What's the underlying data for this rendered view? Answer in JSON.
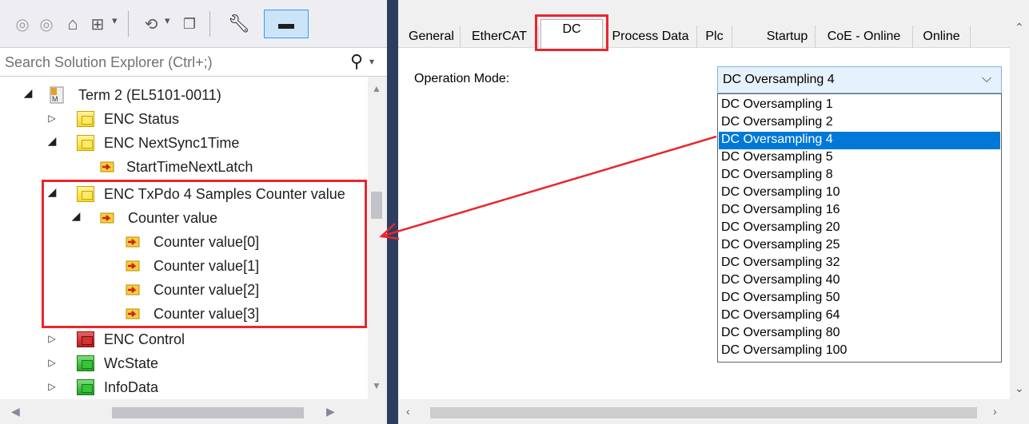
{
  "explorer": {
    "search_placeholder": "Search Solution Explorer (Ctrl+;)",
    "tree": [
      {
        "label": "Term 2 (EL5101-0011)",
        "icon": "terminal-icon",
        "expand": "expanded"
      },
      {
        "label": "ENC Status",
        "icon": "yellow-folder-icon",
        "expand": "collapsed"
      },
      {
        "label": "ENC NextSync1Time",
        "icon": "yellow-folder-icon",
        "expand": "expanded"
      },
      {
        "label": "StartTimeNextLatch",
        "icon": "variable-icon",
        "expand": "none"
      },
      {
        "label": "ENC TxPdo 4 Samples Counter value",
        "icon": "yellow-folder-icon",
        "expand": "expanded"
      },
      {
        "label": "Counter value",
        "icon": "variable-array-icon",
        "expand": "expanded"
      },
      {
        "label": "Counter value[0]",
        "icon": "variable-icon",
        "expand": "none"
      },
      {
        "label": "Counter value[1]",
        "icon": "variable-icon",
        "expand": "none"
      },
      {
        "label": "Counter value[2]",
        "icon": "variable-icon",
        "expand": "none"
      },
      {
        "label": "Counter value[3]",
        "icon": "variable-icon",
        "expand": "none"
      },
      {
        "label": "ENC Control",
        "icon": "red-folder-icon",
        "expand": "collapsed"
      },
      {
        "label": "WcState",
        "icon": "green-folder-icon",
        "expand": "collapsed"
      },
      {
        "label": "InfoData",
        "icon": "green-folder-icon",
        "expand": "collapsed"
      }
    ]
  },
  "tabs": [
    "General",
    "EtherCAT",
    "DC",
    "Process Data",
    "Plc",
    "Startup",
    "CoE - Online",
    "Online"
  ],
  "active_tab": "DC",
  "dc": {
    "operation_mode_label": "Operation Mode:",
    "selected": "DC Oversampling 4",
    "options": [
      "DC Oversampling 1",
      "DC Oversampling 2",
      "DC Oversampling 4",
      "DC Oversampling 5",
      "DC Oversampling 8",
      "DC Oversampling 10",
      "DC Oversampling 16",
      "DC Oversampling 20",
      "DC Oversampling 25",
      "DC Oversampling 32",
      "DC Oversampling 40",
      "DC Oversampling 50",
      "DC Oversampling 64",
      "DC Oversampling 80",
      "DC Oversampling 100"
    ],
    "selected_index": 2
  },
  "colors": {
    "highlight": "#e8262d",
    "selection": "#0078d7",
    "splitter": "#2d3d5f"
  }
}
